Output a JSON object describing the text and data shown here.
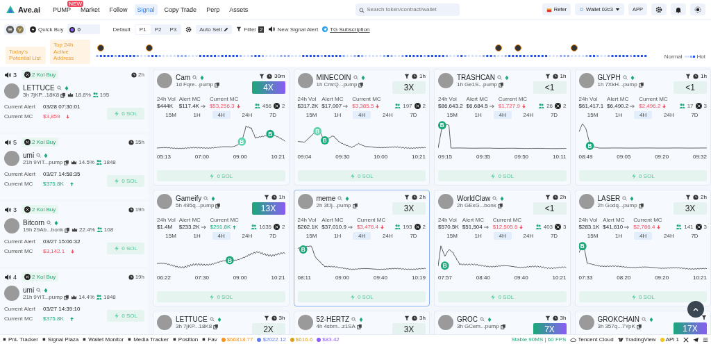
{
  "nav": {
    "logo": "Ave.ai",
    "items": [
      {
        "label": "PUMP",
        "badge": "NEW",
        "selected": false
      },
      {
        "label": "Market",
        "selected": false
      },
      {
        "label": "Follow",
        "selected": false
      },
      {
        "label": "Signal",
        "selected": true
      },
      {
        "label": "Copy Trade",
        "selected": false
      },
      {
        "label": "Perp",
        "selected": false
      },
      {
        "label": "Assets",
        "selected": false
      }
    ],
    "search": {
      "placeholder": "Search token/contract/wallet"
    },
    "refer": "Refer",
    "wallet": "Wallet 02c3",
    "app": "APP"
  },
  "toolbar": {
    "quick_buy": "Quick Buy",
    "amount": "0",
    "default_label": "Default",
    "presets": [
      {
        "label": "P1",
        "selected": true
      },
      {
        "label": "P2",
        "selected": false
      },
      {
        "label": "P3",
        "selected": false
      }
    ],
    "auto_sell": "Auto Sell",
    "filter": "Filter",
    "filter_count": "2",
    "alert": "New Signal Alert",
    "tg": "TG Subscription"
  },
  "strip": {
    "tags": [
      "Today's Potential List",
      "Top 24h Active Address"
    ],
    "legend_low": "Normal",
    "legend_high": "Hot"
  },
  "alerts": [
    {
      "count": "3",
      "kol": "2 Kol Buy",
      "time": "2h",
      "name": "LETTUCE",
      "age": "3h",
      "addr": "7jKP...18K8",
      "share": "18.8%",
      "holders": "195",
      "alert_label": "Current Alert",
      "alert_time": "03/28 07:30:01",
      "mc_label": "Current MC",
      "mc": "$3,859",
      "rising": false,
      "buy": "0 SOL"
    },
    {
      "count": "5",
      "kol": "2 Kol Buy",
      "time": "15h",
      "name": "umi",
      "age": "21h",
      "addr": "9YiT...pump",
      "share": "14.5%",
      "holders": "1848",
      "alert_label": "Current Alert",
      "alert_time": "03/27 14:58:35",
      "mc_label": "Current MC",
      "mc": "$375.8K",
      "rising": true,
      "buy": "0 SOL"
    },
    {
      "count": "3",
      "kol": "2 Kol Buy",
      "time": "19h",
      "name": "Bitcorn",
      "age": "19h",
      "addr": "29Ab...bonk",
      "share": "22.4%",
      "holders": "108",
      "alert_label": "Current Alert",
      "alert_time": "03/27 15:06:32",
      "mc_label": "Current MC",
      "mc": "$3,142.1",
      "rising": false,
      "buy": "0 SOL"
    },
    {
      "count": "4",
      "kol": "2 Kol Buy",
      "time": "19h",
      "name": "umi",
      "age": "21h",
      "addr": "9YiT...pump",
      "share": "14.4%",
      "holders": "1848",
      "alert_label": "Current Alert",
      "alert_time": "03/27 14:39:10",
      "mc_label": "Current MC",
      "mc": "$375.8K",
      "rising": true,
      "buy": "0 SOL"
    }
  ],
  "cards": [
    {
      "name": "Cam",
      "age": "1d",
      "addr": "Fqre...pump",
      "time": "30m",
      "multiple": "4X",
      "kind": "hot",
      "selected": false,
      "stat_labels": [
        "24h Vol",
        "Alert MC",
        "Current MC"
      ],
      "vol": "$444K",
      "alert_mc": "$117.4K",
      "current_mc": "$53,256.3",
      "rising": false,
      "holders": "456",
      "kols": "2",
      "ranges": [
        {
          "label": "15M",
          "selected": false
        },
        {
          "label": "1H",
          "selected": false
        },
        {
          "label": "4H",
          "selected": true
        },
        {
          "label": "24H",
          "selected": false
        },
        {
          "label": "7D",
          "selected": false
        }
      ],
      "axis": [
        "05:13",
        "07:00",
        "09:00",
        "10:21"
      ],
      "markers": [
        "B",
        "B"
      ],
      "buy": "0 SOL"
    },
    {
      "name": "MINECOIN",
      "age": "1h",
      "addr": "CmrQ...pump",
      "time": "1h",
      "multiple": "3X",
      "kind": "normal",
      "selected": false,
      "stat_labels": [
        "24h Vol",
        "Alert MC",
        "Current MC"
      ],
      "vol": "$317.2K",
      "alert_mc": "$17,007",
      "current_mc": "$3,385.5",
      "rising": false,
      "holders": "197",
      "kols": "2",
      "ranges": [
        {
          "label": "15M",
          "selected": false
        },
        {
          "label": "1H",
          "selected": false
        },
        {
          "label": "4H",
          "selected": true
        },
        {
          "label": "24H",
          "selected": false
        },
        {
          "label": "7D",
          "selected": false
        }
      ],
      "axis": [
        "09:04",
        "09:30",
        "10:00",
        "10:21"
      ],
      "markers": [
        "B",
        "B"
      ],
      "buy": "0 SOL"
    },
    {
      "name": "TRASHCAN",
      "age": "1h",
      "addr": "Ge1S...pump",
      "time": "1h",
      "multiple": "<1",
      "kind": "normal",
      "selected": false,
      "stat_labels": [
        "24h Vol",
        "Alert MC",
        "Current MC"
      ],
      "vol": "$86,643.2",
      "alert_mc": "$6,684.5",
      "current_mc": "$1,727.9",
      "rising": false,
      "holders": "26",
      "kols": "2",
      "ranges": [
        {
          "label": "15M",
          "selected": false
        },
        {
          "label": "1H",
          "selected": false
        },
        {
          "label": "4H",
          "selected": true
        },
        {
          "label": "24H",
          "selected": false
        },
        {
          "label": "7D",
          "selected": false
        }
      ],
      "axis": [
        "09:15",
        "09:35",
        "09:50",
        "10:11"
      ],
      "markers": [
        "B"
      ],
      "buy": "0 SOL"
    },
    {
      "name": "GLYPH",
      "age": "1h",
      "addr": "7XkH...pump",
      "time": "1h",
      "multiple": "<1",
      "kind": "normal",
      "selected": false,
      "stat_labels": [
        "24h Vol",
        "Alert MC",
        "Current MC"
      ],
      "vol": "$61,417.1",
      "alert_mc": "$6,490.2",
      "current_mc": "$2,496.2",
      "rising": false,
      "holders": "17",
      "kols": "3",
      "ranges": [
        {
          "label": "15M",
          "selected": false
        },
        {
          "label": "1H",
          "selected": false
        },
        {
          "label": "4H",
          "selected": true
        },
        {
          "label": "24H",
          "selected": false
        },
        {
          "label": "7D",
          "selected": false
        }
      ],
      "axis": [
        "08:49",
        "09:05",
        "09:20",
        "09:32"
      ],
      "markers": [
        "B"
      ],
      "buy": "0 SOL"
    },
    {
      "name": "Gameify",
      "age": "5h",
      "addr": "495q...pump",
      "time": "1h",
      "multiple": "13X",
      "kind": "hot",
      "selected": false,
      "stat_labels": [
        "24h Vol",
        "Alert MC",
        "Current MC"
      ],
      "vol": "$1.4M",
      "alert_mc": "$233.2K",
      "current_mc": "$291.8K",
      "rising": true,
      "holders": "1635",
      "kols": "2",
      "ranges": [
        {
          "label": "15M",
          "selected": false
        },
        {
          "label": "1H",
          "selected": false
        },
        {
          "label": "4H",
          "selected": true
        },
        {
          "label": "24H",
          "selected": false
        },
        {
          "label": "7D",
          "selected": false
        }
      ],
      "axis": [
        "06:22",
        "07:30",
        "09:00",
        "10:21"
      ],
      "markers": [
        "B"
      ],
      "buy": "0 SOL"
    },
    {
      "name": "meme",
      "age": "2h",
      "addr": "3fJj...pump",
      "time": "2h",
      "multiple": "3X",
      "kind": "normal",
      "selected": true,
      "stat_labels": [
        "24h Vol",
        "Alert MC",
        "Current MC"
      ],
      "vol": "$262.1K",
      "alert_mc": "$37,010.9",
      "current_mc": "$3,476.4",
      "rising": false,
      "holders": "193",
      "kols": "2",
      "ranges": [
        {
          "label": "15M",
          "selected": false
        },
        {
          "label": "1H",
          "selected": false
        },
        {
          "label": "4H",
          "selected": true
        },
        {
          "label": "24H",
          "selected": false
        },
        {
          "label": "7D",
          "selected": false
        }
      ],
      "axis": [
        "08:11",
        "09:00",
        "09:40",
        "10:19"
      ],
      "markers": [
        "B"
      ],
      "buy": "0 SOL"
    },
    {
      "name": "WorldClaw",
      "age": "2h",
      "addr": "GExG...bonk",
      "time": "2h",
      "multiple": "<1",
      "kind": "normal",
      "selected": false,
      "stat_labels": [
        "24h Vol",
        "Alert MC",
        "Current MC"
      ],
      "vol": "$570.5K",
      "alert_mc": "$51,504",
      "current_mc": "$12,505.6",
      "rising": false,
      "holders": "403",
      "kols": "3",
      "ranges": [
        {
          "label": "15M",
          "selected": false
        },
        {
          "label": "1H",
          "selected": false
        },
        {
          "label": "4H",
          "selected": true
        },
        {
          "label": "24H",
          "selected": false
        },
        {
          "label": "7D",
          "selected": false
        }
      ],
      "axis": [
        "07:57",
        "08:40",
        "09:40",
        "10:21"
      ],
      "markers": [
        "B"
      ],
      "buy": "0 SOL"
    },
    {
      "name": "LASER",
      "age": "2h",
      "addr": "Godq...pump",
      "time": "2h",
      "multiple": "3X",
      "kind": "normal",
      "selected": false,
      "stat_labels": [
        "24h Vol",
        "Alert MC",
        "Current MC"
      ],
      "vol": "$283.1K",
      "alert_mc": "$41,610",
      "current_mc": "$2,786.4",
      "rising": false,
      "holders": "141",
      "kols": "3",
      "ranges": [
        {
          "label": "15M",
          "selected": false
        },
        {
          "label": "1H",
          "selected": false
        },
        {
          "label": "4H",
          "selected": true
        },
        {
          "label": "24H",
          "selected": false
        },
        {
          "label": "7D",
          "selected": false
        }
      ],
      "axis": [
        "07:33",
        "08:20",
        "09:20",
        "10:21"
      ],
      "markers": [
        "B"
      ],
      "buy": "0 SOL"
    },
    {
      "name": "LETTUCE",
      "age": "3h",
      "addr": "7jKP...18K8",
      "time": "3h",
      "multiple": "2X",
      "kind": "normal",
      "selected": false
    },
    {
      "name": "52-HERTZ",
      "age": "4h",
      "addr": "4sbm...z1SA",
      "time": "3h",
      "multiple": "3X",
      "kind": "normal",
      "selected": false
    },
    {
      "name": "GROC",
      "age": "3h",
      "addr": "GCem...pump",
      "time": "3h",
      "multiple": "7X",
      "kind": "hot",
      "selected": false
    },
    {
      "name": "GROKCHAIN",
      "age": "3h",
      "addr": "357q...7YpK",
      "multiple": "17X",
      "kind": "hot",
      "selected": false
    }
  ],
  "status_bar": {
    "tools": [
      "PnL Tracker",
      "Signal Plaza",
      "Wallet Monitor",
      "Media Tracker",
      "Position",
      "Fav"
    ],
    "prices": [
      {
        "value": "$66818.77",
        "color": "#f7931a"
      },
      {
        "value": "$2022.12",
        "color": "#627eea"
      },
      {
        "value": "$616.6",
        "color": "#d9a21b"
      },
      {
        "value": "$83.42",
        "color": "#8b5cf6"
      }
    ],
    "latency": "Stable 90MS | 60 FPS",
    "cloud": "Tencent Cloud",
    "charting": "TradingView",
    "api": "API",
    "count": "1"
  }
}
